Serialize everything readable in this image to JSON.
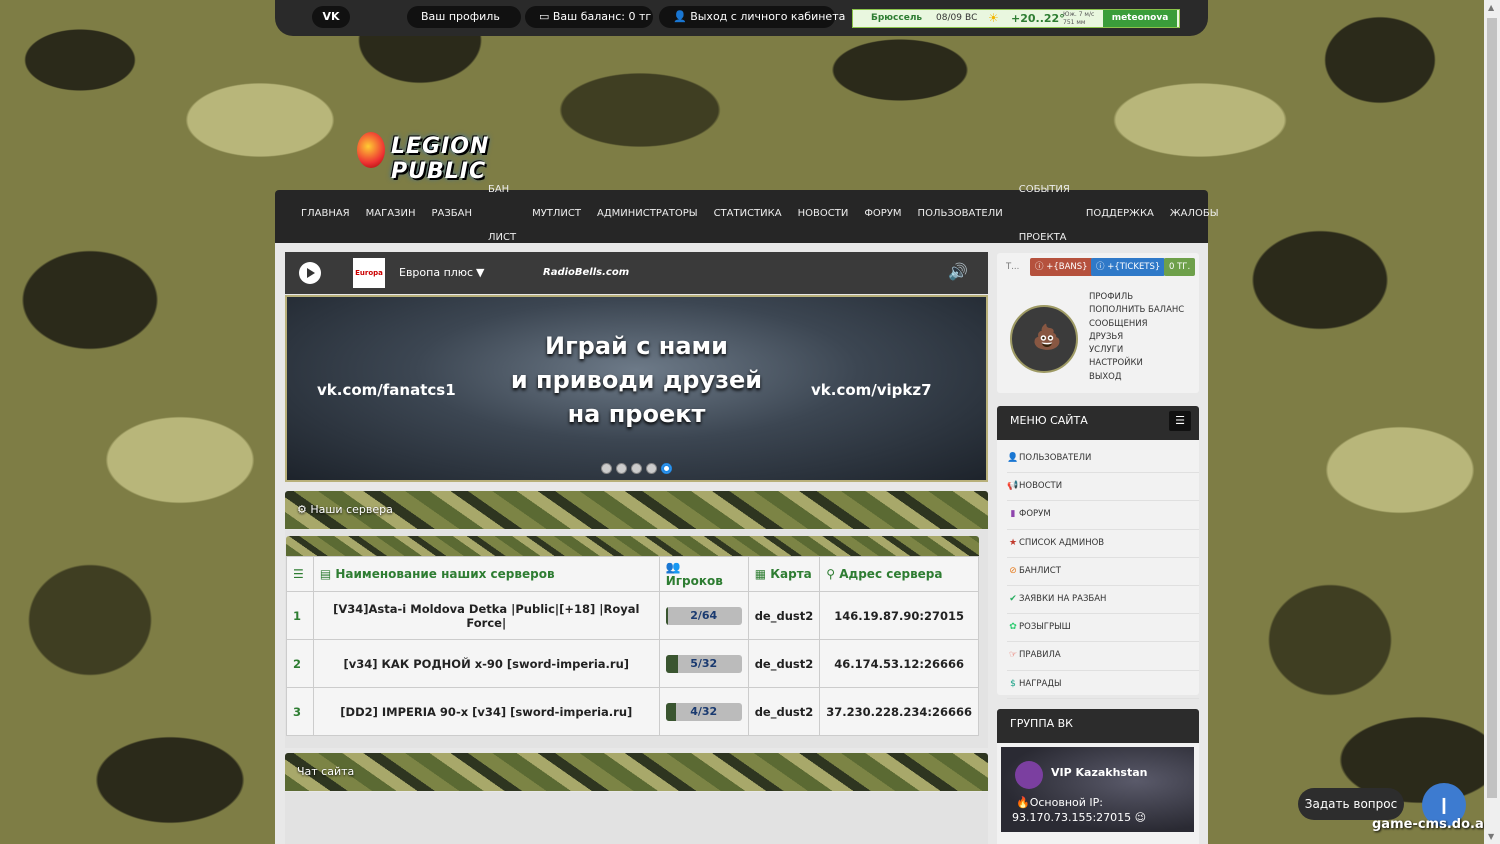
{
  "topbar": {
    "vk_icon": "vk-icon",
    "profile": "Ваш профиль",
    "balance": "Ваш баланс: 0 тг",
    "logout": "Выход с личного кабинета",
    "weather": {
      "city": "Брюссель",
      "date": "08/09",
      "day": "ВС",
      "temp": "+20..22°",
      "wind": "Юж. 7 м/с",
      "pressure": "751 мм",
      "brand": "meteonova"
    }
  },
  "logo": {
    "text": "LEGION PUBLIC"
  },
  "nav": {
    "items": [
      "ГЛАВНАЯ",
      "МАГАЗИН",
      "РАЗБАН",
      "БАН ЛИСТ",
      "МУТЛИСТ",
      "АДМИНИСТРАТОРЫ",
      "СТАТИСТИКА",
      "НОВОСТИ",
      "ФОРУМ",
      "ПОЛЬЗОВАТЕЛИ",
      "СОБЫТИЯ ПРОЕКТА",
      "ПОДДЕРЖКА",
      "ЖАЛОБЫ"
    ]
  },
  "radio": {
    "station_logo": "Europa Plus",
    "station": "Европа плюс",
    "arrow": "▼",
    "brand": "RadioBells.com"
  },
  "banner": {
    "title": "Играй с нами\nи приводи друзей\nна проект",
    "left_link": "vk.com/fanatcs1",
    "right_link": "vk.com/vipkz7",
    "slides": 5,
    "active_slide": 5
  },
  "servers": {
    "title": "Наши сервера",
    "headers": {
      "num_icon": "list-icon",
      "name": "Наименование наших серверов",
      "players": "Игроков",
      "map": "Карта",
      "address": "Адрес сервера"
    },
    "rows": [
      {
        "num": "1",
        "name": "[V34]Asta-i Moldova Detka |Public|[+18] |Royal Force|",
        "players": "2/64",
        "fill": 0.03,
        "map": "de_dust2",
        "address": "146.19.87.90:27015"
      },
      {
        "num": "2",
        "name": "[v34] КАК РОДНОЙ x-90 [sword-imperia.ru]",
        "players": "5/32",
        "fill": 0.16,
        "map": "de_dust2",
        "address": "46.174.53.12:26666"
      },
      {
        "num": "3",
        "name": "[DD2] IMPERIA 90-x [v34] [sword-imperia.ru]",
        "players": "4/32",
        "fill": 0.13,
        "map": "de_dust2",
        "address": "37.230.228.234:26666"
      }
    ]
  },
  "chat": {
    "title": "Чат сайта"
  },
  "profile": {
    "tab": "Т...",
    "badges": {
      "bans": "+{BANS}",
      "tickets": "+{TICKETS}",
      "balance": "0 ТГ."
    },
    "links": [
      "ПРОФИЛЬ",
      "ПОПОЛНИТЬ БАЛАНС",
      "СООБЩЕНИЯ",
      "ДРУЗЬЯ",
      "УСЛУГИ",
      "НАСТРОЙКИ",
      "ВЫХОД"
    ]
  },
  "site_menu": {
    "title": "МЕНЮ САЙТА",
    "items": [
      {
        "label": "ПОЛЬЗОВАТЕЛИ",
        "icon": "user-icon",
        "glyph": "👤",
        "color": "#2a9d8f"
      },
      {
        "label": "НОВОСТИ",
        "icon": "bullhorn-icon",
        "glyph": "📢",
        "color": "#c9b400"
      },
      {
        "label": "ФОРУМ",
        "icon": "bar-chart-icon",
        "glyph": "▮",
        "color": "#8e44ad"
      },
      {
        "label": "СПИСОК АДМИНОВ",
        "icon": "star-icon",
        "glyph": "★",
        "color": "#c0392b"
      },
      {
        "label": "БАНЛИСТ",
        "icon": "ban-icon",
        "glyph": "⊘",
        "color": "#e67e22"
      },
      {
        "label": "ЗАЯВКИ НА РАЗБАН",
        "icon": "check-circle-icon",
        "glyph": "✔",
        "color": "#27ae60"
      },
      {
        "label": "РОЗЫГРЫШ",
        "icon": "gift-icon",
        "glyph": "✿",
        "color": "#2ecc71"
      },
      {
        "label": "ПРАВИЛА",
        "icon": "hand-pointer-icon",
        "glyph": "☞",
        "color": "#e74c3c"
      },
      {
        "label": "НАГРАДЫ",
        "icon": "dollar-icon",
        "glyph": "$",
        "color": "#16a085"
      }
    ]
  },
  "vk_group": {
    "title": "ГРУППА ВК",
    "card_title": "VIP Kazakhstan",
    "line1": "Основной IP:",
    "line2": "93.170.73.155:27015"
  },
  "support": {
    "ask": "Задать вопрос",
    "watermark": "game-cms.do.am"
  }
}
